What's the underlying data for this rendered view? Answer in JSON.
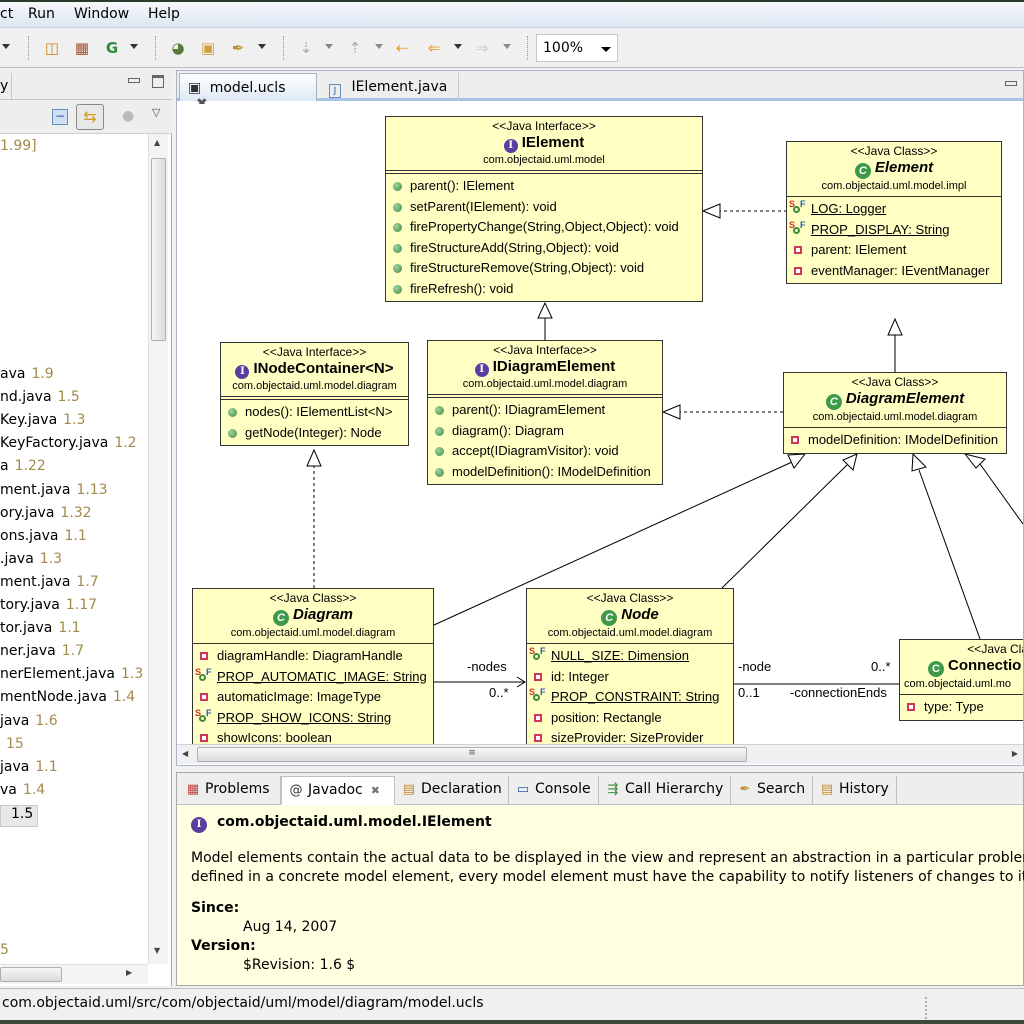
{
  "menu": [
    "ct",
    "Run",
    "Window",
    "Help"
  ],
  "toolbar": {
    "zoom_value": "100%",
    "icons": [
      "new-java-project-icon",
      "new-package-icon",
      "new-class-icon",
      "open-type-icon",
      "open-folder-icon",
      "search-torch-icon",
      "next-annotation-icon",
      "prev-annotation-icon",
      "last-edit-icon",
      "back-icon",
      "forward-icon"
    ]
  },
  "left_panel": {
    "tab_label": "y",
    "first_row": "1.99]",
    "rows": [
      {
        "name": "ava",
        "rev": "1.9"
      },
      {
        "name": "nd.java",
        "rev": "1.5"
      },
      {
        "name": "Key.java",
        "rev": "1.3"
      },
      {
        "name": "KeyFactory.java",
        "rev": "1.2"
      },
      {
        "name": "a",
        "rev": "1.22"
      },
      {
        "name": "ment.java",
        "rev": "1.13"
      },
      {
        "name": "ory.java",
        "rev": "1.32"
      },
      {
        "name": "ons.java",
        "rev": "1.1"
      },
      {
        "name": ".java",
        "rev": "1.3"
      },
      {
        "name": "ment.java",
        "rev": "1.7"
      },
      {
        "name": "tory.java",
        "rev": "1.17"
      },
      {
        "name": "tor.java",
        "rev": "1.1"
      },
      {
        "name": "ner.java",
        "rev": "1.7"
      },
      {
        "name": "nerElement.java",
        "rev": "1.3"
      },
      {
        "name": "mentNode.java",
        "rev": "1.4"
      },
      {
        "name": "java",
        "rev": "1.6"
      },
      {
        "name": "",
        "rev": "15"
      },
      {
        "name": "java",
        "rev": "1.1"
      },
      {
        "name": "va",
        "rev": "1.4"
      },
      {
        "name": "",
        "rev": "1.5"
      }
    ],
    "last_row": "5"
  },
  "editor": {
    "tabs": [
      {
        "label": "model.ucls",
        "active": true
      },
      {
        "label": "IElement.java",
        "active": false
      }
    ]
  },
  "diagram": {
    "boxes": {
      "ielement": {
        "stereotype": "<<Java Interface>>",
        "name": "IElement",
        "package": "com.objectaid.uml.model",
        "members": [
          {
            "kind": "pub",
            "text": "parent(): IElement"
          },
          {
            "kind": "pub",
            "text": "setParent(IElement): void"
          },
          {
            "kind": "pub",
            "text": "firePropertyChange(String,Object,Object): void"
          },
          {
            "kind": "pub",
            "text": "fireStructureAdd(String,Object): void"
          },
          {
            "kind": "pub",
            "text": "fireStructureRemove(String,Object): void"
          },
          {
            "kind": "pub",
            "text": "fireRefresh(): void"
          }
        ]
      },
      "element": {
        "stereotype": "<<Java Class>>",
        "name": "Element",
        "package": "com.objectaid.uml.model.impl",
        "members": [
          {
            "kind": "sf",
            "text": "LOG: Logger"
          },
          {
            "kind": "sf",
            "text": "PROP_DISPLAY: String"
          },
          {
            "kind": "priv",
            "text": "parent: IElement"
          },
          {
            "kind": "priv",
            "text": "eventManager: IEventManager"
          }
        ]
      },
      "inodecontainer": {
        "stereotype": "<<Java Interface>>",
        "name": "INodeContainer<N>",
        "package": "com.objectaid.uml.model.diagram",
        "members": [
          {
            "kind": "pub",
            "text": "nodes(): IElementList<N>"
          },
          {
            "kind": "pub",
            "text": "getNode(Integer): Node"
          }
        ]
      },
      "idiagramelement": {
        "stereotype": "<<Java Interface>>",
        "name": "IDiagramElement",
        "package": "com.objectaid.uml.model.diagram",
        "members": [
          {
            "kind": "pub",
            "text": "parent(): IDiagramElement"
          },
          {
            "kind": "pub",
            "text": "diagram(): Diagram"
          },
          {
            "kind": "pub",
            "text": "accept(IDiagramVisitor): void"
          },
          {
            "kind": "pub",
            "text": "modelDefinition(): IModelDefinition"
          }
        ]
      },
      "diagramelement": {
        "stereotype": "<<Java Class>>",
        "name": "DiagramElement",
        "package": "com.objectaid.uml.model.diagram",
        "members": [
          {
            "kind": "priv",
            "text": "modelDefinition: IModelDefinition"
          }
        ]
      },
      "diagram": {
        "stereotype": "<<Java Class>>",
        "name": "Diagram",
        "package": "com.objectaid.uml.model.diagram",
        "members": [
          {
            "kind": "priv",
            "text": "diagramHandle: DiagramHandle"
          },
          {
            "kind": "sf",
            "text": "PROP_AUTOMATIC_IMAGE: String"
          },
          {
            "kind": "priv",
            "text": "automaticImage: ImageType"
          },
          {
            "kind": "sf",
            "text": "PROP_SHOW_ICONS: String"
          },
          {
            "kind": "priv",
            "text": "showIcons: boolean"
          }
        ]
      },
      "node": {
        "stereotype": "<<Java Class>>",
        "name": "Node",
        "package": "com.objectaid.uml.model.diagram",
        "members": [
          {
            "kind": "sf",
            "text": "NULL_SIZE: Dimension"
          },
          {
            "kind": "priv",
            "text": "id: Integer"
          },
          {
            "kind": "sf",
            "text": "PROP_CONSTRAINT: String"
          },
          {
            "kind": "priv",
            "text": "position: Rectangle"
          },
          {
            "kind": "priv",
            "text": "sizeProvider: SizeProvider"
          }
        ]
      },
      "connection": {
        "stereotype": "<<Java Clas",
        "name": "Connectio",
        "package": "com.objectaid.uml.mo",
        "members": [
          {
            "kind": "priv",
            "text": "type: Type"
          }
        ]
      }
    },
    "labels": {
      "nodes_role": "-nodes",
      "nodes_mult": "0..*",
      "node_role": "-node",
      "node_mult": "0..1",
      "conn_role": "-connectionEnds",
      "conn_mult": "0..*"
    }
  },
  "bottom_panel": {
    "tabs": [
      {
        "label": "Problems",
        "icon": "problems-icon",
        "active": false
      },
      {
        "label": "Javadoc",
        "icon": "javadoc-icon",
        "active": true
      },
      {
        "label": "Declaration",
        "icon": "declaration-icon",
        "active": false
      },
      {
        "label": "Console",
        "icon": "console-icon",
        "active": false
      },
      {
        "label": "Call Hierarchy",
        "icon": "call-hierarchy-icon",
        "active": false
      },
      {
        "label": "Search",
        "icon": "search-icon",
        "active": false
      },
      {
        "label": "History",
        "icon": "history-icon",
        "active": false
      }
    ],
    "javadoc": {
      "title": "com.objectaid.uml.model.IElement",
      "desc_line1": "Model elements contain the actual data to be displayed in the view and represent an abstraction in a particular problem dor",
      "desc_line2": "defined in a concrete model element, every model element must have the capability to notify listeners of changes to its dat",
      "since_label": "Since:",
      "since_value": "Aug 14, 2007",
      "version_label": "Version:",
      "version_value": "$Revision: 1.6 $"
    }
  },
  "status_bar": {
    "path": "com.objectaid.uml/src/com/objectaid/uml/model/diagram/model.ucls"
  }
}
